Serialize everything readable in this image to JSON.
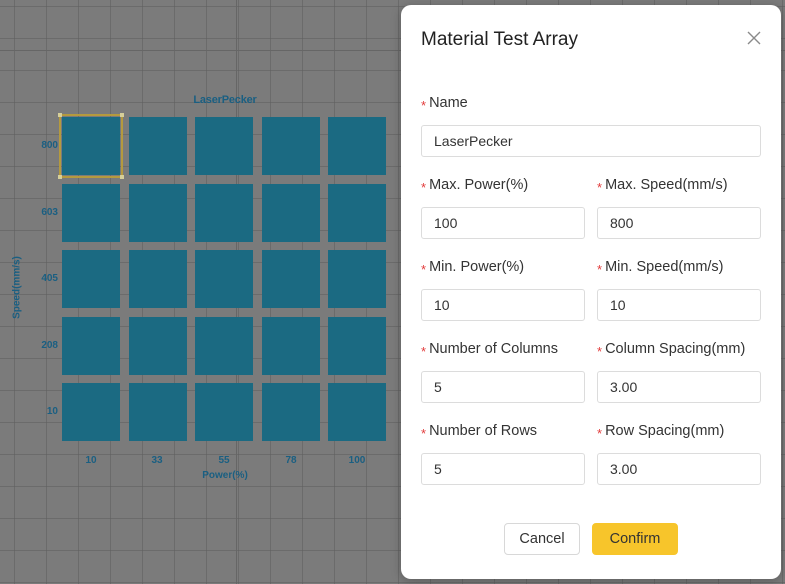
{
  "canvas": {
    "array_title": "LaserPecker",
    "y_axis_label": "Speed(mm/s)",
    "x_axis_label": "Power(%)",
    "row_labels": [
      "800",
      "603",
      "405",
      "208",
      "10"
    ],
    "col_labels": [
      "10",
      "33",
      "55",
      "78",
      "100"
    ],
    "cell_color": "#1b6a82",
    "selected_cell": {
      "row": 0,
      "col": 0
    }
  },
  "dialog": {
    "title": "Material Test Array",
    "close_icon": "close-icon",
    "fields": {
      "name": {
        "label": "Name",
        "value": "LaserPecker"
      },
      "max_power": {
        "label": "Max. Power(%)",
        "value": "100"
      },
      "max_speed": {
        "label": "Max. Speed(mm/s)",
        "value": "800"
      },
      "min_power": {
        "label": "Min. Power(%)",
        "value": "10"
      },
      "min_speed": {
        "label": "Min. Speed(mm/s)",
        "value": "10"
      },
      "num_columns": {
        "label": "Number of Columns",
        "value": "5"
      },
      "column_spacing": {
        "label": "Column Spacing(mm)",
        "value": "3.00"
      },
      "num_rows": {
        "label": "Number of Rows",
        "value": "5"
      },
      "row_spacing": {
        "label": "Row Spacing(mm)",
        "value": "3.00"
      }
    },
    "required_marker": "*",
    "cancel_label": "Cancel",
    "confirm_label": "Confirm",
    "accent_color": "#f7c52b"
  }
}
